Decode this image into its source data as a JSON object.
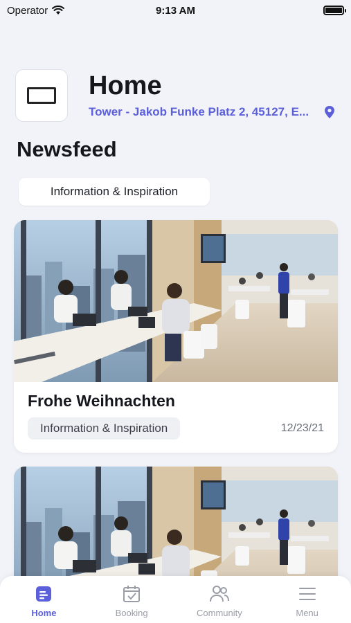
{
  "status_bar": {
    "carrier": "Operator",
    "time": "9:13 AM"
  },
  "header": {
    "title": "Home",
    "location": "Tower - Jakob Funke Platz 2, 45127, E..."
  },
  "newsfeed": {
    "title": "Newsfeed",
    "filter_label": "Information & Inspiration"
  },
  "posts": [
    {
      "title": "Frohe Weihnachten",
      "tag": "Information & Inspiration",
      "date": "12/23/21"
    },
    {
      "title": "",
      "tag": "",
      "date": ""
    }
  ],
  "tabs": [
    {
      "label": "Home",
      "icon": "home-document-icon",
      "active": true
    },
    {
      "label": "Booking",
      "icon": "calendar-check-icon",
      "active": false
    },
    {
      "label": "Community",
      "icon": "people-icon",
      "active": false
    },
    {
      "label": "Menu",
      "icon": "menu-icon",
      "active": false
    }
  ],
  "colors": {
    "accent": "#5b5fd8",
    "background": "#f1f3f8"
  }
}
